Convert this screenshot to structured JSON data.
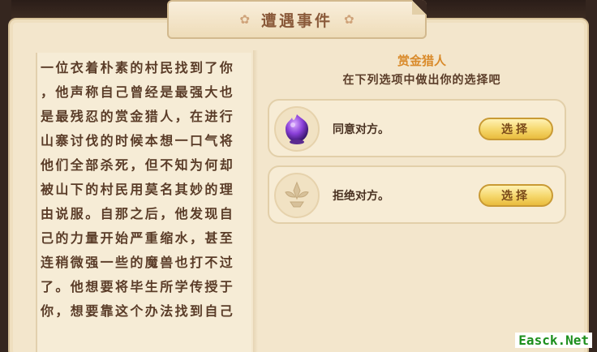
{
  "dialog": {
    "title": "遭遇事件",
    "title_ornament_left": "✿",
    "title_ornament_right": "✿"
  },
  "story": {
    "lines": [
      "一位衣着朴素的村民找到了你",
      "，他声称自己曾经是最强大也",
      "是最残忍的赏金猎人，在进行",
      "山寨讨伐的时候本想一口气将",
      "他们全部杀死，但不知为何却",
      "被山下的村民用莫名其妙的理",
      "由说服。自那之后，他发现自",
      "己的力量开始严重缩水，甚至",
      "连稍微强一些的魔兽也打不过",
      "了。他想要将毕生所学传授于",
      "你，想要靠这个办法找到自己"
    ]
  },
  "event": {
    "name": "赏金猎人",
    "prompt": "在下列选项中做出你的选择吧"
  },
  "options": [
    {
      "label": "同意对方。",
      "button": "选择",
      "icon": "purple-orb-icon"
    },
    {
      "label": "拒绝对方。",
      "button": "选择",
      "icon": "emblem-icon"
    }
  ],
  "watermark": "Easck.Net",
  "colors": {
    "accent_orange": "#d98a2a",
    "button_gold": "#f5d66a",
    "text_brown": "#5a3c28",
    "parchment": "#f3e6cc"
  }
}
